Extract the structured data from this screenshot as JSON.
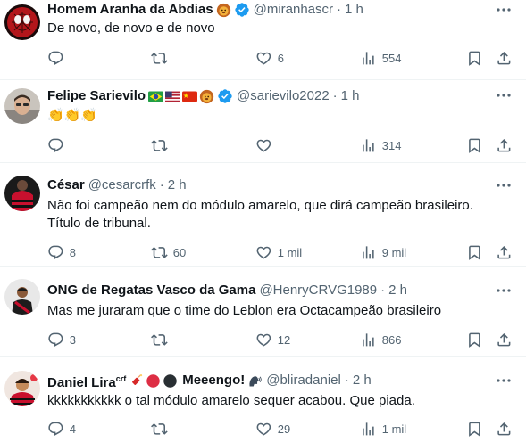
{
  "tweets": [
    {
      "name": "Homem Aranha da Abdias",
      "handle": "@miranhascr",
      "time": "1 h",
      "text_lines": [
        "De novo, de novo e de novo"
      ],
      "replies": "",
      "retweets": "",
      "likes": "6",
      "views": "554",
      "emojis": [
        "lion-emoji"
      ],
      "verified": true,
      "avatar": "red-spider-avatar"
    },
    {
      "name": "Felipe Sarievilo",
      "handle": "@sarievilo2022",
      "time": "1 h",
      "text_lines": [
        "👏👏👏"
      ],
      "replies": "",
      "retweets": "",
      "likes": "",
      "views": "314",
      "emojis": [
        "brazil-flag-emoji",
        "usa-flag-emoji",
        "china-flag-emoji",
        "lion-emoji"
      ],
      "verified": true,
      "avatar": "person-photo-avatar"
    },
    {
      "name": "César",
      "handle": "@cesarcrfk",
      "time": "2 h",
      "text_lines": [
        "Não foi campeão nem do módulo amarelo, que dirá campeão brasileiro.",
        "Título de tribunal."
      ],
      "replies": "8",
      "retweets": "60",
      "likes": "1 mil",
      "views": "9 mil",
      "emojis": [],
      "verified": false,
      "avatar": "flamengo-jersey-avatar"
    },
    {
      "name": "ONG de Regatas Vasco da Gama",
      "handle": "@HenryCRVG1989",
      "time": "2 h",
      "text_lines": [
        "Mas me juraram que o time do Leblon era Octacampeão brasileiro"
      ],
      "replies": "3",
      "retweets": "",
      "likes": "12",
      "views": "866",
      "emojis": [],
      "verified": false,
      "avatar": "player-photo-avatar"
    },
    {
      "name": "Daniel Lira",
      "name_sup": "crf",
      "name_suffix": "Meeengo!",
      "handle": "@bliradaniel",
      "time": "2 h",
      "text_lines": [
        "kkkkkkkkkkk o tal módulo amarelo sequer acabou. Que piada."
      ],
      "replies": "4",
      "retweets": "",
      "likes": "29",
      "views": "1 mil",
      "emojis": [
        "firecracker-emoji",
        "red-circle-emoji",
        "black-circle-emoji"
      ],
      "suffix_emojis": [
        "speaking-head-emoji"
      ],
      "verified": false,
      "avatar": "illustrated-avatar"
    }
  ],
  "colors": {
    "text": "#0f1419",
    "secondary": "#536471",
    "verified": "#1d9bf0",
    "divider": "#eff3f4"
  }
}
